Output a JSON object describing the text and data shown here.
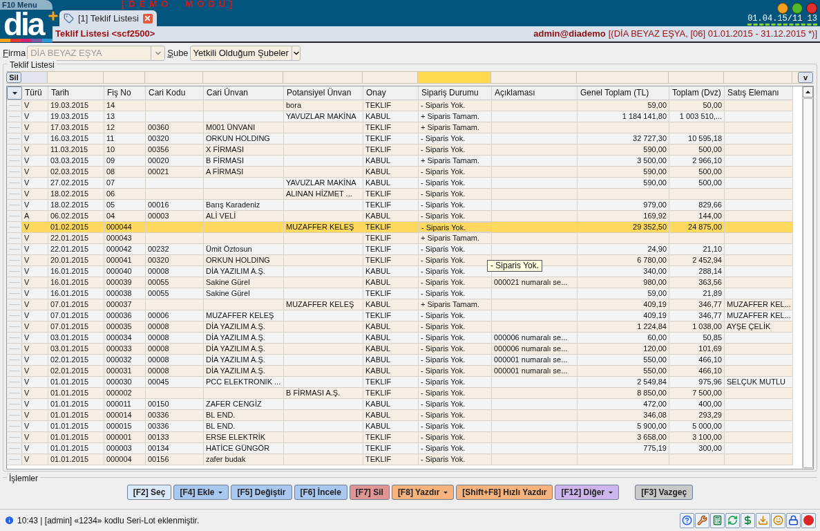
{
  "menu_tab": "F10 Menu",
  "demo_banner": "[DEMO  MODU]",
  "logo": "dia",
  "tabs": [
    {
      "label": "[1] Teklif Listesi",
      "selected": true
    }
  ],
  "clock": "01.04.15/11 13",
  "header": {
    "title": "Teklif Listesi <scf2500>",
    "user": "admin@diademo",
    "context": "[(DİA BEYAZ EŞYA, [06] 01.01.2015 - 31.12.2015 *)]"
  },
  "filters": [
    {
      "label": "Firma",
      "value": "DİA BEYAZ EŞYA",
      "disabled": true
    },
    {
      "label": "Şube",
      "value": "Yetkili Olduğum Şubeler",
      "disabled": false
    }
  ],
  "group_title": "Teklif Listesi",
  "filter_row": {
    "clear_button": "Sil",
    "toggle_button": "v"
  },
  "table": {
    "columns": [
      {
        "label": "Türü",
        "kind": "text",
        "selected": false
      },
      {
        "label": "Tarih",
        "kind": "text",
        "selected": false
      },
      {
        "label": "Fiş No",
        "kind": "text",
        "selected": false
      },
      {
        "label": "Cari Kodu",
        "kind": "text",
        "selected": false
      },
      {
        "label": "Cari Ünvan",
        "kind": "text",
        "selected": false
      },
      {
        "label": "Potansiyel Ünvan",
        "kind": "text",
        "selected": false
      },
      {
        "label": "Onay",
        "kind": "text",
        "selected": false
      },
      {
        "label": "Sipariş Durumu",
        "kind": "text",
        "selected": true
      },
      {
        "label": "Açıklaması",
        "kind": "text",
        "selected": false
      },
      {
        "label": "Genel Toplam (TL)",
        "kind": "amount",
        "selected": false
      },
      {
        "label": "Toplam (Dvz)",
        "kind": "amount",
        "selected": false
      },
      {
        "label": "Satış Elemanı",
        "kind": "text",
        "selected": false
      }
    ],
    "rows": [
      {
        "selected": false,
        "cells": [
          "V",
          "19.03.2015",
          "14",
          "",
          "",
          "bora",
          "TEKLIF",
          "- Siparis Yok.",
          "",
          "59,00",
          "50,00",
          ""
        ]
      },
      {
        "selected": false,
        "cells": [
          "V",
          "19.03.2015",
          "13",
          "",
          "",
          "YAVUZLAR MAKİNA",
          "KABUL",
          "+ Siparis Tamam.",
          "",
          "1 184 141,80",
          "1 003 510,...",
          ""
        ]
      },
      {
        "selected": false,
        "cells": [
          "V",
          "17.03.2015",
          "12",
          "00360",
          "M001 ÜNVANI",
          "",
          "TEKLIF",
          "+ Siparis Tamam.",
          "",
          "",
          "",
          ""
        ]
      },
      {
        "selected": false,
        "cells": [
          "V",
          "16.03.2015",
          "11",
          "00320",
          "ORKUN HOLDING",
          "",
          "TEKLIF",
          "- Siparis Yok.",
          "",
          "32 727,30",
          "10 595,18",
          ""
        ]
      },
      {
        "selected": false,
        "cells": [
          "V",
          "11.03.2015",
          "10",
          "00356",
          "X FİRMASI",
          "",
          "TEKLIF",
          "- Siparis Yok.",
          "",
          "590,00",
          "500,00",
          ""
        ]
      },
      {
        "selected": false,
        "cells": [
          "V",
          "03.03.2015",
          "09",
          "00020",
          "B FİRMASI",
          "",
          "KABUL",
          "+ Siparis Tamam.",
          "",
          "3 500,00",
          "2 966,10",
          ""
        ]
      },
      {
        "selected": false,
        "cells": [
          "V",
          "02.03.2015",
          "08",
          "00021",
          "A FİRMASI",
          "",
          "KABUL",
          "- Siparis Yok.",
          "",
          "590,00",
          "500,00",
          ""
        ]
      },
      {
        "selected": false,
        "cells": [
          "V",
          "27.02.2015",
          "07",
          "",
          "",
          "YAVUZLAR MAKİNA",
          "KABUL",
          "- Siparis Yok.",
          "",
          "590,00",
          "500,00",
          ""
        ]
      },
      {
        "selected": false,
        "cells": [
          "V",
          "18.02.2015",
          "06",
          "",
          "",
          "ALINAN HİZMET ...",
          "TEKLIF",
          "- Siparis Yok.",
          "",
          "",
          "",
          ""
        ]
      },
      {
        "selected": false,
        "cells": [
          "V",
          "18.02.2015",
          "05",
          "00016",
          "Barış Karadeniz",
          "",
          "TEKLIF",
          "- Siparis Yok.",
          "",
          "979,00",
          "829,66",
          ""
        ]
      },
      {
        "selected": false,
        "cells": [
          "A",
          "06.02.2015",
          "04",
          "00003",
          "ALİ VELİ",
          "",
          "KABUL",
          "- Siparis Yok.",
          "",
          "169,92",
          "144,00",
          ""
        ]
      },
      {
        "selected": true,
        "cells": [
          "V",
          "01.02.2015",
          "000044",
          "",
          "",
          "MUZAFFER KELEŞ",
          "TEKLIF",
          "- Siparis Yok.",
          "",
          "29 352,50",
          "24 875,00",
          ""
        ]
      },
      {
        "selected": false,
        "cells": [
          "V",
          "22.01.2015",
          "000043",
          "",
          "",
          "",
          "TEKLIF",
          "+ Siparis Tamam.",
          "",
          "",
          "",
          ""
        ]
      },
      {
        "selected": false,
        "cells": [
          "V",
          "22.01.2015",
          "000042",
          "00232",
          "Ümit Öztosun",
          "",
          "TEKLIF",
          "- Siparis Yok.",
          "",
          "24,90",
          "21,10",
          ""
        ]
      },
      {
        "selected": false,
        "cells": [
          "V",
          "20.01.2015",
          "000041",
          "00320",
          "ORKUN HOLDING",
          "",
          "TEKLIF",
          "- Siparis Yok.",
          "",
          "6 780,00",
          "2 452,94",
          ""
        ]
      },
      {
        "selected": false,
        "cells": [
          "V",
          "16.01.2015",
          "000040",
          "00008",
          "DİA YAZILIM A.Ş.",
          "",
          "KABUL",
          "- Siparis Yok.",
          "",
          "340,00",
          "288,14",
          ""
        ]
      },
      {
        "selected": false,
        "cells": [
          "V",
          "16.01.2015",
          "000039",
          "00055",
          "Sakine Gürel",
          "",
          "KABUL",
          "- Siparis Yok.",
          "000021 numaralı se...",
          "980,00",
          "363,56",
          ""
        ]
      },
      {
        "selected": false,
        "cells": [
          "V",
          "16.01.2015",
          "000038",
          "00055",
          "Sakine Gürel",
          "",
          "TEKLIF",
          "- Siparis Yok.",
          "",
          "59,00",
          "21,89",
          ""
        ]
      },
      {
        "selected": false,
        "cells": [
          "V",
          "07.01.2015",
          "000037",
          "",
          "",
          "MUZAFFER KELEŞ",
          "KABUL",
          "+ Siparis Tamam.",
          "",
          "409,19",
          "346,77",
          "MUZAFFER KEL..."
        ]
      },
      {
        "selected": false,
        "cells": [
          "V",
          "07.01.2015",
          "000036",
          "00006",
          "MUZAFFER KELEŞ",
          "",
          "TEKLIF",
          "- Siparis Yok.",
          "",
          "409,19",
          "346,77",
          "MUZAFFER KEL..."
        ]
      },
      {
        "selected": false,
        "cells": [
          "V",
          "07.01.2015",
          "000035",
          "00008",
          "DİA YAZILIM A.Ş.",
          "",
          "KABUL",
          "- Siparis Yok.",
          "",
          "1 224,84",
          "1 038,00",
          "AYŞE ÇELİK"
        ]
      },
      {
        "selected": false,
        "cells": [
          "V",
          "03.01.2015",
          "000034",
          "00008",
          "DİA YAZILIM A.Ş.",
          "",
          "KABUL",
          "- Siparis Yok.",
          "000006 numaralı se...",
          "60,00",
          "50,85",
          ""
        ]
      },
      {
        "selected": false,
        "cells": [
          "V",
          "03.01.2015",
          "000033",
          "00008",
          "DİA YAZILIM A.Ş.",
          "",
          "KABUL",
          "- Siparis Yok.",
          "000006 numaralı se...",
          "120,00",
          "101,69",
          ""
        ]
      },
      {
        "selected": false,
        "cells": [
          "V",
          "02.01.2015",
          "000032",
          "00008",
          "DİA YAZILIM A.Ş.",
          "",
          "KABUL",
          "- Siparis Yok.",
          "000001 numaralı se...",
          "550,00",
          "466,10",
          ""
        ]
      },
      {
        "selected": false,
        "cells": [
          "V",
          "02.01.2015",
          "000031",
          "00008",
          "DİA YAZILIM A.Ş.",
          "",
          "KABUL",
          "- Siparis Yok.",
          "000001 numaralı se...",
          "550,00",
          "466,10",
          ""
        ]
      },
      {
        "selected": false,
        "cells": [
          "V",
          "01.01.2015",
          "000030",
          "00045",
          "PCC ELEKTRONIK ...",
          "",
          "TEKLIF",
          "- Siparis Yok.",
          "",
          "2 549,84",
          "975,96",
          "SELÇUK MUTLU"
        ]
      },
      {
        "selected": false,
        "cells": [
          "V",
          "01.01.2015",
          "000002",
          "",
          "",
          "B FİRMASI A.Ş.",
          "TEKLIF",
          "- Siparis Yok.",
          "",
          "8 850,00",
          "7 500,00",
          ""
        ]
      },
      {
        "selected": false,
        "cells": [
          "V",
          "01.01.2015",
          "000011",
          "00150",
          "ZAFER CENGİZ",
          "",
          "KABUL",
          "- Siparis Yok.",
          "",
          "472,00",
          "400,00",
          ""
        ]
      },
      {
        "selected": false,
        "cells": [
          "V",
          "01.01.2015",
          "000014",
          "00336",
          "BL END.",
          "",
          "KABUL",
          "- Siparis Yok.",
          "",
          "346,08",
          "293,29",
          ""
        ]
      },
      {
        "selected": false,
        "cells": [
          "V",
          "01.01.2015",
          "000015",
          "00336",
          "BL END.",
          "",
          "KABUL",
          "- Siparis Yok.",
          "",
          "5 900,00",
          "5 000,00",
          ""
        ]
      },
      {
        "selected": false,
        "cells": [
          "V",
          "01.01.2015",
          "000001",
          "00133",
          "ERSE ELEKTRİK",
          "",
          "TEKLIF",
          "- Siparis Yok.",
          "",
          "3 658,00",
          "3 100,00",
          ""
        ]
      },
      {
        "selected": false,
        "cells": [
          "V",
          "01.01.2015",
          "000003",
          "00134",
          "HATİCE GÜNGÖR",
          "",
          "TEKLIF",
          "- Siparis Yok.",
          "",
          "775,19",
          "300,00",
          ""
        ]
      },
      {
        "selected": false,
        "cells": [
          "V",
          "01.01.2015",
          "000004",
          "00156",
          "zafer budak",
          "",
          "TEKLIF",
          "- Siparis Yok.",
          "",
          "",
          "",
          ""
        ]
      }
    ]
  },
  "tooltip": "- Siparis Yok.",
  "actions_title": "İşlemler",
  "actions": [
    {
      "label": "[F2] Seç",
      "color": "#dce9f8",
      "menu": false
    },
    {
      "label": "[F4] Ekle",
      "color": "#a8c8ef",
      "menu": true
    },
    {
      "label": "[F5] Değiştir",
      "color": "#a8c8ef",
      "menu": false
    },
    {
      "label": "[F6] İncele",
      "color": "#a8c8ef",
      "menu": false
    },
    {
      "label": "[F7] Sil",
      "color": "#e09595",
      "menu": false
    },
    {
      "label": "[F8] Yazdır",
      "color": "#f8b37d",
      "menu": true
    },
    {
      "label": "[Shift+F8] Hızlı Yazdır",
      "color": "#f8b37d",
      "menu": false
    },
    {
      "label": "[F12] Diğer",
      "color": "#cdb6ee",
      "menu": true
    },
    {
      "label": "[F3] Vazgeç",
      "color": "#c9c9c9",
      "menu": false
    }
  ],
  "status": {
    "message": "10:43 | [admin] «1234» kodlu Seri-Lot eklenmiştir."
  }
}
